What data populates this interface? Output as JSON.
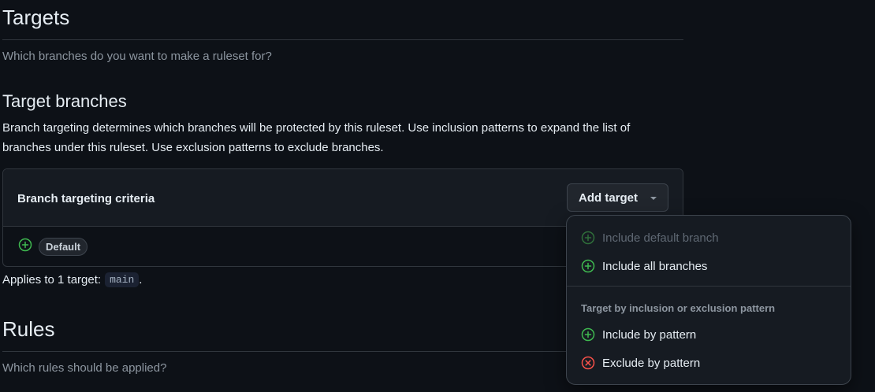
{
  "targets": {
    "heading": "Targets",
    "description": "Which branches do you want to make a ruleset for?"
  },
  "target_branches": {
    "heading": "Target branches",
    "description": "Branch targeting determines which branches will be protected by this ruleset. Use inclusion patterns to expand the list of branches under this ruleset. Use exclusion patterns to exclude branches.",
    "criteria_title": "Branch targeting criteria",
    "add_target_label": "Add target",
    "criteria_badge": "Default",
    "applies_prefix": "Applies to 1 target:",
    "applies_code": "main",
    "applies_suffix": "."
  },
  "rules": {
    "heading": "Rules",
    "description": "Which rules should be applied?"
  },
  "dropdown": {
    "items": [
      {
        "label": "Include default branch",
        "icon": "plus-circle-icon",
        "disabled": true
      },
      {
        "label": "Include all branches",
        "icon": "plus-circle-icon",
        "disabled": false
      }
    ],
    "group_label": "Target by inclusion or exclusion pattern",
    "pattern_items": [
      {
        "label": "Include by pattern",
        "icon": "plus-circle-icon"
      },
      {
        "label": "Exclude by pattern",
        "icon": "x-circle-icon"
      }
    ]
  },
  "colors": {
    "background": "#0d1117",
    "success": "#3fb950",
    "danger": "#f85149",
    "muted": "#8d96a0",
    "border": "#30363d"
  }
}
